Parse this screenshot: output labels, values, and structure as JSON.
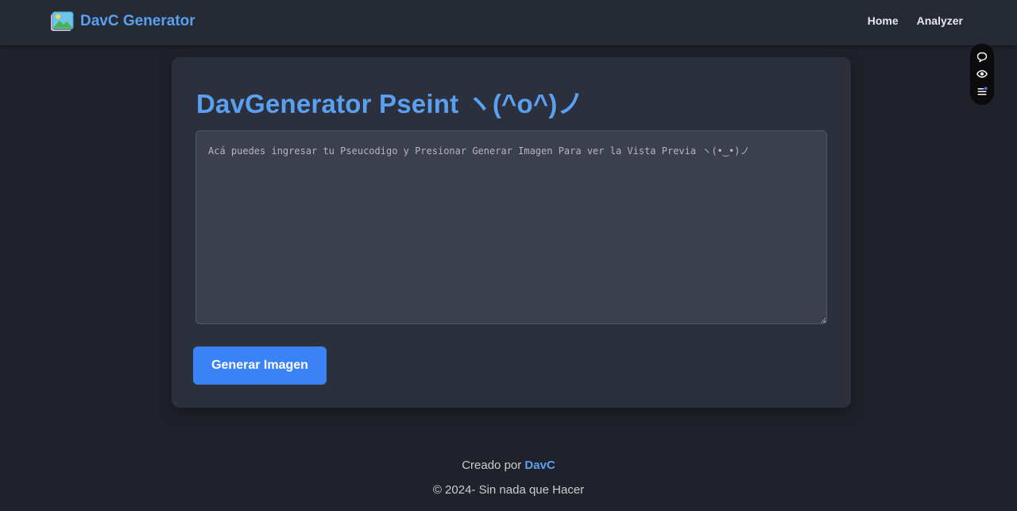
{
  "header": {
    "brand": "DavC Generator",
    "logo_icon": "image-gallery-icon",
    "nav": [
      {
        "label": "Home"
      },
      {
        "label": "Analyzer"
      }
    ]
  },
  "main": {
    "title": "DavGenerator Pseint ヽ(^o^)ノ",
    "editor": {
      "value": "",
      "placeholder": "Acá puedes ingresar tu Pseucodigo y Presionar Generar Imagen Para ver la Vista Previa ヽ(•‿•)ノ"
    },
    "generate_label": "Generar Imagen"
  },
  "side_toolbar": {
    "icons": [
      "chat-bubble-icon",
      "eye-icon",
      "menu-list-icon"
    ]
  },
  "footer": {
    "created_by_prefix": "Creado por ",
    "author": "DavC",
    "copyright": "© 2024- Sin nada que Hacer"
  },
  "colors": {
    "accent": "#5aa0f0",
    "button": "#3b82f6",
    "background": "#1f222b",
    "card": "#2c303c",
    "navbar": "#262a34"
  }
}
